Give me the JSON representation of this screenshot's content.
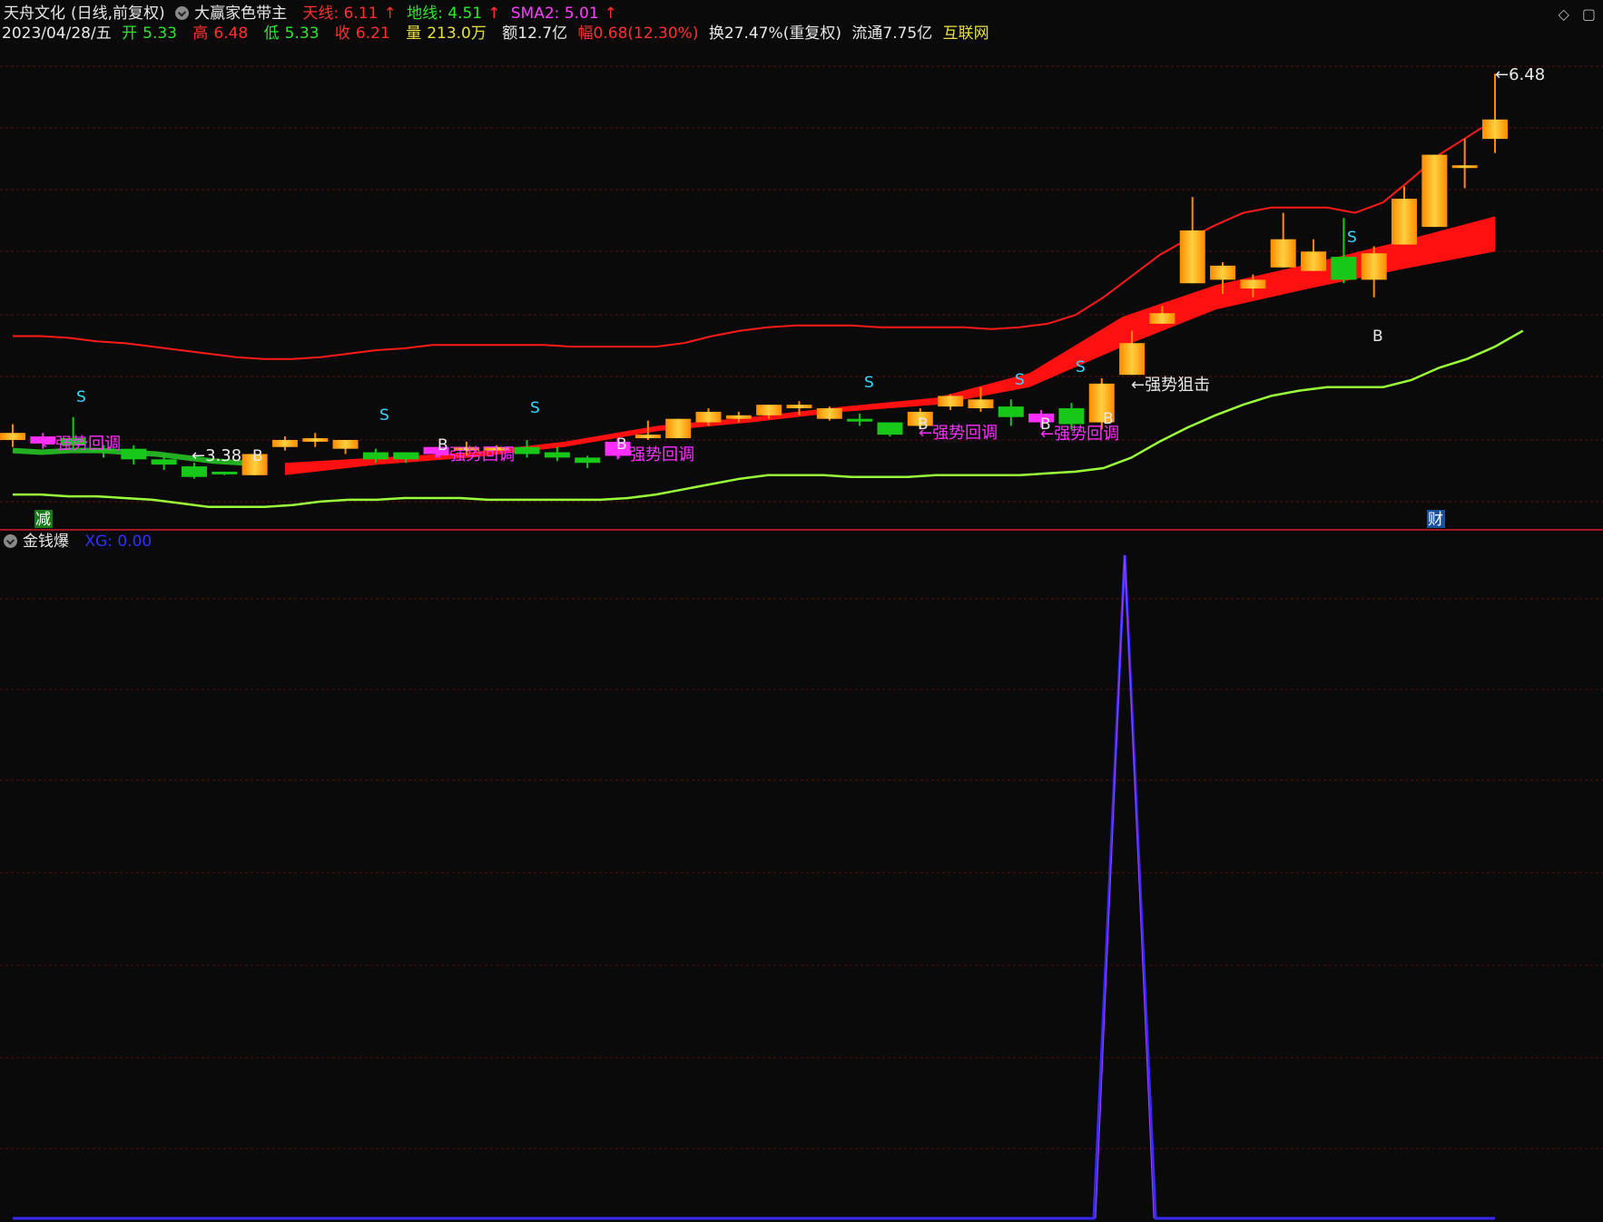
{
  "header": {
    "stock_name": "天舟文化",
    "period_label": "(日线,前复权)",
    "indicator_name": "大赢家色带主",
    "tianxian": "天线: 6.11",
    "dixian": "地线: 4.51",
    "sma2": "SMA2: 5.01",
    "date": "2023/04/28/五",
    "open_label": "开",
    "open_value": "5.33",
    "high_label": "高",
    "high_value": "6.48",
    "low_label": "低",
    "low_value": "5.33",
    "close_label": "收",
    "close_value": "6.21",
    "volume_label": "量",
    "volume_value": "213.0万",
    "amount": "额12.7亿",
    "change": "幅0.68(12.30%)",
    "turnover": "换27.47%(重复权)",
    "float": "流通7.75亿",
    "sector": "互联网"
  },
  "indicator": {
    "name": "金钱爆",
    "xg": "XG: 0.00"
  },
  "colors": {
    "bg": "#0a0a0a",
    "up_a": "#ff8a00",
    "up_b": "#ffd040",
    "down": "#18c818",
    "magenta": "#ff30ff",
    "red_line": "#ff1a1a",
    "green_line": "#9aff3a",
    "grid": "#5a1010",
    "s_label": "#38d8ff",
    "spike": "#3a2aff"
  },
  "chart_data": [
    {
      "type": "candlestick",
      "title": "大赢家色带主",
      "candles": [
        [
          4.44,
          4.4,
          4.49,
          4.36,
          "up"
        ],
        [
          4.38,
          4.42,
          4.44,
          4.35,
          "m"
        ],
        [
          4.37,
          4.41,
          4.53,
          4.34,
          "down"
        ],
        [
          4.35,
          4.34,
          4.37,
          4.3,
          "down"
        ],
        [
          4.29,
          4.35,
          4.37,
          4.26,
          "down"
        ],
        [
          4.26,
          4.29,
          4.32,
          4.23,
          "down"
        ],
        [
          4.19,
          4.25,
          4.27,
          4.18,
          "down"
        ],
        [
          4.21,
          4.22,
          4.22,
          4.2,
          "down"
        ],
        [
          4.32,
          4.2,
          4.33,
          4.2,
          "up"
        ],
        [
          4.4,
          4.36,
          4.42,
          4.34,
          "up"
        ],
        [
          4.41,
          4.39,
          4.44,
          4.36,
          "up"
        ],
        [
          4.4,
          4.35,
          4.4,
          4.32,
          "up"
        ],
        [
          4.33,
          4.29,
          4.35,
          4.27,
          "down"
        ],
        [
          4.33,
          4.29,
          4.32,
          4.27,
          "down"
        ],
        [
          4.36,
          4.32,
          4.36,
          4.3,
          "m"
        ],
        [
          4.36,
          4.34,
          4.39,
          4.31,
          "up"
        ],
        [
          4.36,
          4.34,
          4.37,
          4.32,
          "up"
        ],
        [
          4.36,
          4.32,
          4.4,
          4.3,
          "down"
        ],
        [
          4.33,
          4.3,
          4.36,
          4.28,
          "down"
        ],
        [
          4.3,
          4.27,
          4.31,
          4.24,
          "down"
        ],
        [
          4.39,
          4.31,
          4.41,
          4.29,
          "m"
        ],
        [
          4.43,
          4.41,
          4.51,
          4.4,
          "up"
        ],
        [
          4.52,
          4.41,
          4.52,
          4.41,
          "up"
        ],
        [
          4.56,
          4.5,
          4.58,
          4.48,
          "up"
        ],
        [
          4.54,
          4.52,
          4.56,
          4.5,
          "up"
        ],
        [
          4.6,
          4.54,
          4.6,
          4.52,
          "up"
        ],
        [
          4.6,
          4.58,
          4.62,
          4.54,
          "up"
        ],
        [
          4.58,
          4.52,
          4.59,
          4.51,
          "up"
        ],
        [
          4.52,
          4.52,
          4.55,
          4.48,
          "down"
        ],
        [
          4.5,
          4.43,
          4.5,
          4.42,
          "down"
        ],
        [
          4.56,
          4.48,
          4.58,
          4.46,
          "up"
        ],
        [
          4.65,
          4.59,
          4.66,
          4.57,
          "up"
        ],
        [
          4.63,
          4.58,
          4.7,
          4.56,
          "up"
        ],
        [
          4.53,
          4.59,
          4.63,
          4.48,
          "down"
        ],
        [
          4.55,
          4.5,
          4.57,
          4.47,
          "m"
        ],
        [
          4.49,
          4.58,
          4.61,
          4.46,
          "down"
        ],
        [
          4.5,
          4.72,
          4.75,
          4.46,
          "up"
        ],
        [
          4.77,
          4.95,
          5.02,
          4.77,
          "up"
        ],
        [
          5.06,
          5.12,
          5.16,
          5.06,
          "up"
        ],
        [
          5.29,
          5.59,
          5.78,
          5.29,
          "up"
        ],
        [
          5.31,
          5.39,
          5.41,
          5.23,
          "up"
        ],
        [
          5.26,
          5.31,
          5.34,
          5.21,
          "up"
        ],
        [
          5.38,
          5.54,
          5.69,
          5.38,
          "up"
        ],
        [
          5.36,
          5.47,
          5.54,
          5.36,
          "up"
        ],
        [
          5.31,
          5.44,
          5.66,
          5.29,
          "down"
        ],
        [
          5.31,
          5.46,
          5.5,
          5.21,
          "up"
        ],
        [
          5.51,
          5.77,
          5.84,
          5.51,
          "up"
        ],
        [
          5.61,
          6.02,
          6.02,
          5.61,
          "up"
        ],
        [
          5.96,
          5.96,
          6.11,
          5.83,
          "up"
        ],
        [
          6.22,
          6.11,
          6.48,
          6.03,
          "up"
        ]
      ],
      "ma_band_start": [
        4.34,
        4.33,
        4.34,
        4.34,
        4.33,
        4.32,
        4.3,
        4.28,
        4.27
      ],
      "band_upper": [
        4.99,
        4.99,
        4.98,
        4.96,
        4.95,
        4.93,
        4.91,
        4.89,
        4.87,
        4.86,
        4.86,
        4.87,
        4.89,
        4.91,
        4.92,
        4.94,
        4.94,
        4.94,
        4.94,
        4.94,
        4.93,
        4.93,
        4.93,
        4.93,
        4.95,
        4.99,
        5.02,
        5.04,
        5.05,
        5.05,
        5.05,
        5.04,
        5.04,
        5.04,
        5.04,
        5.03,
        5.04,
        5.06,
        5.11,
        5.21,
        5.33,
        5.45,
        5.54,
        5.62,
        5.69,
        5.72,
        5.72,
        5.72,
        5.69,
        5.75,
        5.88,
        6.02,
        6.12,
        6.22
      ],
      "band_lower": [
        4.09,
        4.09,
        4.08,
        4.08,
        4.07,
        4.06,
        4.04,
        4.02,
        4.02,
        4.02,
        4.03,
        4.05,
        4.06,
        4.06,
        4.07,
        4.07,
        4.07,
        4.06,
        4.06,
        4.06,
        4.06,
        4.06,
        4.07,
        4.09,
        4.12,
        4.15,
        4.18,
        4.2,
        4.2,
        4.2,
        4.19,
        4.19,
        4.19,
        4.2,
        4.2,
        4.2,
        4.2,
        4.21,
        4.22,
        4.24,
        4.3,
        4.39,
        4.47,
        4.54,
        4.6,
        4.65,
        4.68,
        4.7,
        4.7,
        4.7,
        4.74,
        4.81,
        4.86,
        4.93,
        5.02
      ],
      "red_band": [
        [
          4.2,
          4.27
        ],
        [
          4.26,
          4.3
        ],
        [
          4.3,
          4.33
        ],
        [
          4.36,
          4.39
        ],
        [
          4.45,
          4.48
        ],
        [
          4.5,
          4.53
        ],
        [
          4.56,
          4.59
        ],
        [
          4.6,
          4.64
        ],
        [
          4.7,
          4.78
        ],
        [
          4.93,
          5.1
        ],
        [
          5.14,
          5.28
        ],
        [
          5.26,
          5.4
        ],
        [
          5.37,
          5.53
        ],
        [
          5.47,
          5.67
        ]
      ],
      "ylim": [
        3.9,
        6.6
      ],
      "annotations": [
        {
          "text": "S",
          "color": "cyan"
        },
        {
          "text": "←强势回调",
          "color": "magenta"
        },
        {
          "text": "←3.38",
          "color": "white"
        },
        {
          "text": "B",
          "color": "white"
        },
        {
          "text": "S",
          "color": "cyan"
        },
        {
          "text": "B",
          "color": "white"
        },
        {
          "text": "←强势回调",
          "color": "magenta"
        },
        {
          "text": "S",
          "color": "cyan"
        },
        {
          "text": "B",
          "color": "white"
        },
        {
          "text": "←强势回调",
          "color": "magenta"
        },
        {
          "text": "S",
          "color": "cyan"
        },
        {
          "text": "B",
          "color": "white"
        },
        {
          "text": "←强势回调",
          "color": "magenta"
        },
        {
          "text": "S",
          "color": "cyan"
        },
        {
          "text": "B",
          "color": "white"
        },
        {
          "text": "←强势回调",
          "color": "magenta"
        },
        {
          "text": "S",
          "color": "cyan"
        },
        {
          "text": "B",
          "color": "white"
        },
        {
          "text": "←强势狙击",
          "color": "white"
        },
        {
          "text": "S",
          "color": "cyan"
        },
        {
          "text": "B",
          "color": "white"
        },
        {
          "text": "←6.48",
          "color": "white"
        }
      ],
      "badges": [
        {
          "text": "减",
          "color": "#1a7a1a"
        },
        {
          "text": "财",
          "color": "#1a50a0"
        }
      ]
    },
    {
      "type": "line",
      "title": "金钱爆",
      "series": [
        {
          "name": "XG",
          "values": [
            0,
            1,
            0
          ]
        }
      ],
      "spike_index": 37,
      "ylim": [
        0,
        1
      ]
    }
  ]
}
